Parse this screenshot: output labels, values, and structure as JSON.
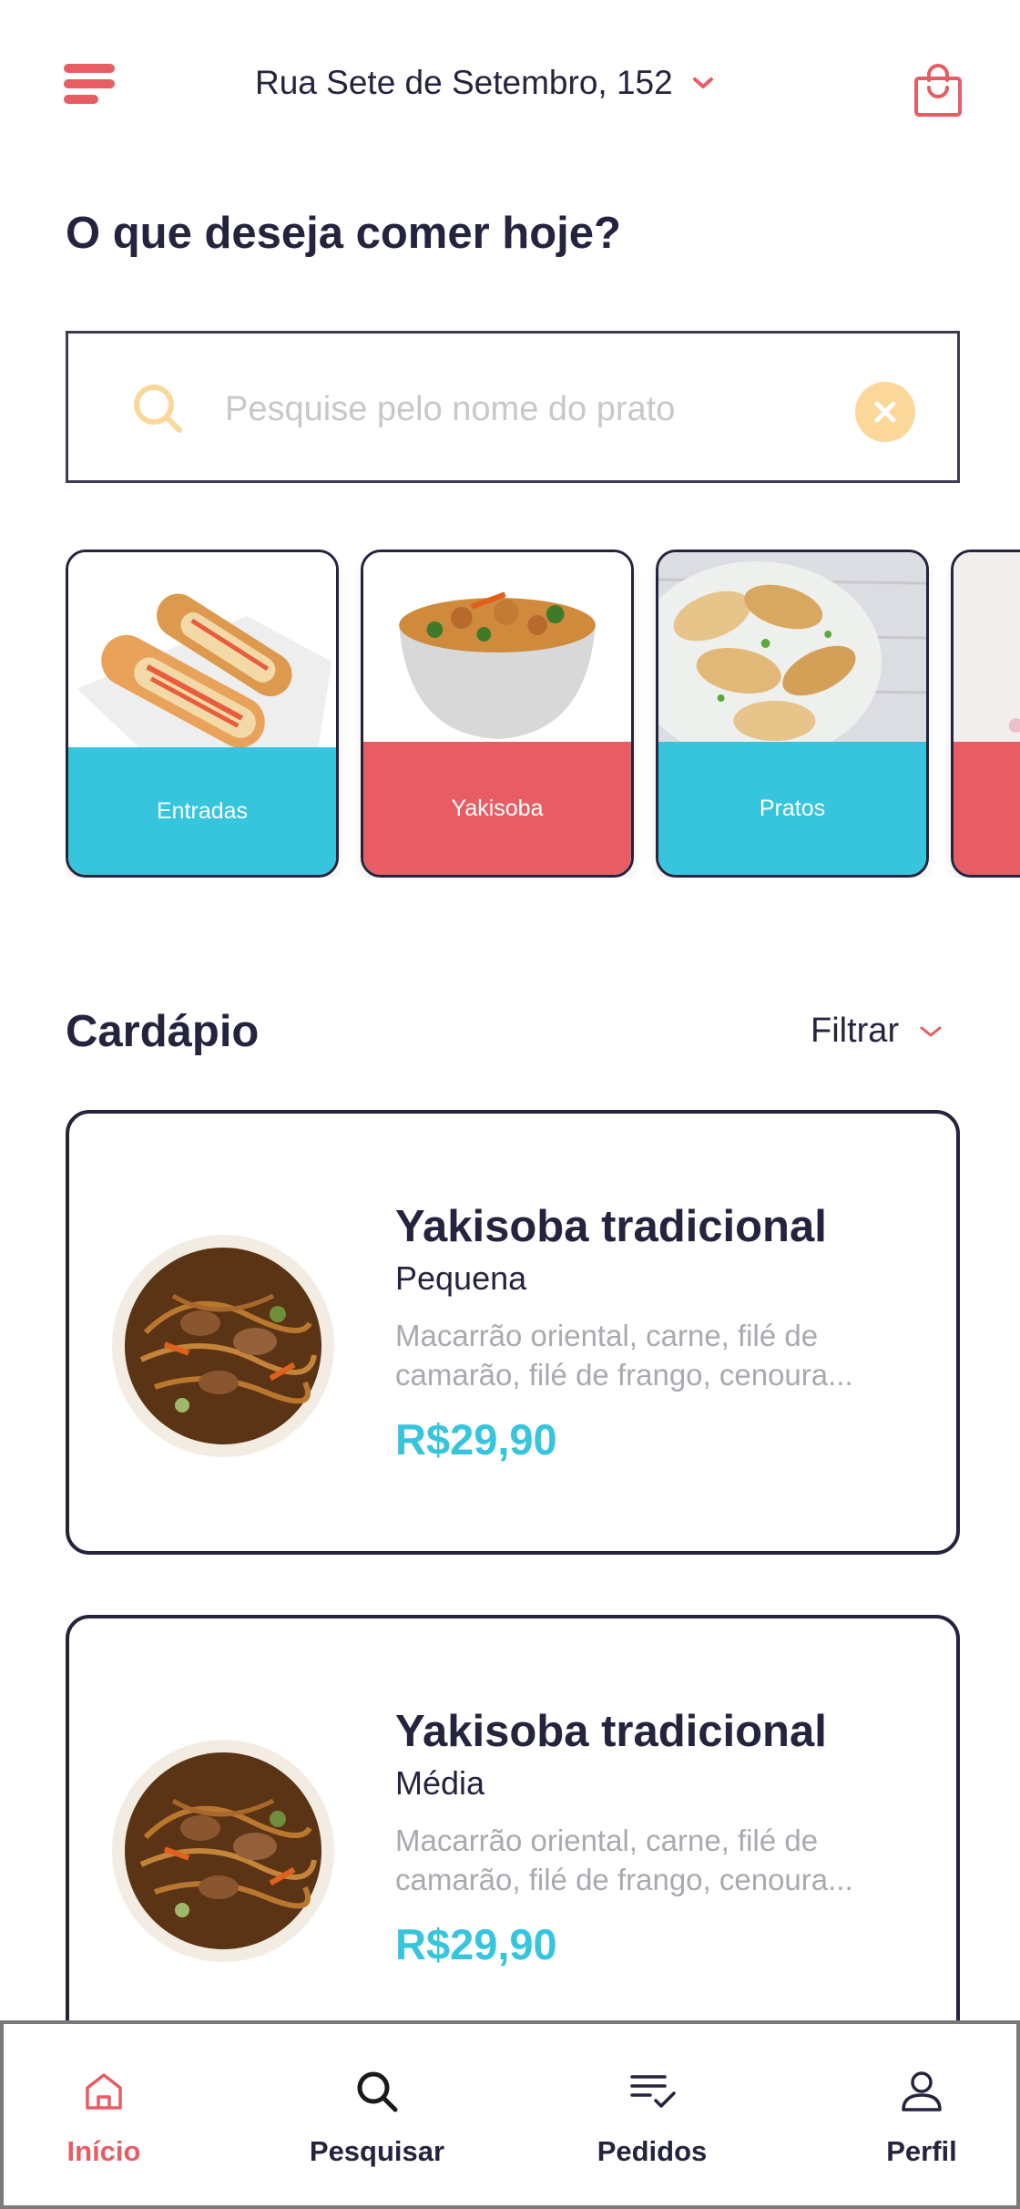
{
  "header": {
    "address": "Rua Sete de Setembro, 152",
    "menu_icon": "hamburger-menu-icon",
    "bag_icon": "shopping-bag-icon"
  },
  "greeting": "O que deseja comer hoje?",
  "search": {
    "placeholder": "Pesquise pelo nome do prato",
    "value": "",
    "icon": "search-icon",
    "clear_icon": "close-icon"
  },
  "categories": [
    {
      "label": "Entradas",
      "color": "#36c5dd",
      "image": "spring-rolls"
    },
    {
      "label": "Yakisoba",
      "color": "#e85d64",
      "image": "yakisoba-bowl"
    },
    {
      "label": "Pratos",
      "color": "#36c5dd",
      "image": "gyoza-plate"
    },
    {
      "label": "",
      "color": "#e85d64",
      "image": "partially-visible"
    }
  ],
  "menu": {
    "title": "Cardápio",
    "filter_label": "Filtrar",
    "items": [
      {
        "name": "Yakisoba tradicional",
        "size": "Pequena",
        "description": "Macarrão oriental, carne, filé de camarão, filé de frango, cenoura...",
        "price": "R$29,90"
      },
      {
        "name": "Yakisoba tradicional",
        "size": "Média",
        "description": "Macarrão oriental, carne, filé de camarão, filé de frango, cenoura...",
        "price": "R$29,90"
      }
    ]
  },
  "bottom_nav": {
    "items": [
      {
        "label": "Início",
        "icon": "home-icon",
        "active": true
      },
      {
        "label": "Pesquisar",
        "icon": "search-icon",
        "active": false
      },
      {
        "label": "Pedidos",
        "icon": "orders-list-icon",
        "active": false
      },
      {
        "label": "Perfil",
        "icon": "user-icon",
        "active": false
      }
    ]
  },
  "colors": {
    "accent_red": "#e85d64",
    "accent_cyan": "#36c5dd",
    "text_dark": "#24243f",
    "muted": "#a9a9b0"
  }
}
